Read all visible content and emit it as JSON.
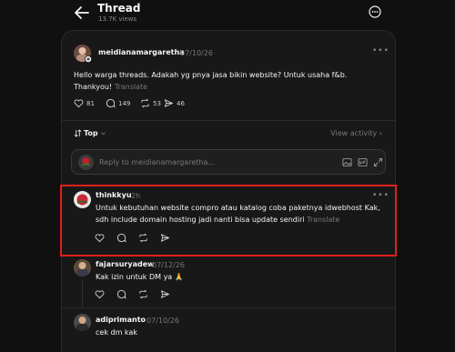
{
  "header": {
    "title": "Thread",
    "views": "13.7K views"
  },
  "main_post": {
    "username": "meidianamargaretha",
    "date": "07/10/26",
    "text_line1": "Hello warga threads. Adakah yg pnya jasa bikin website? Untuk usaha f&b.",
    "text_line2": "Thankyou!",
    "translate": "Translate",
    "likes": "81",
    "comments": "149",
    "reposts": "53",
    "shares": "46"
  },
  "sort": {
    "label": "Top",
    "view_activity": "View activity"
  },
  "reply": {
    "placeholder": "Reply to meidianamargaretha..."
  },
  "replies": [
    {
      "username": "thinkkyu",
      "time": "2h",
      "text_line1": "Untuk kebutuhan website compro atau katalog coba paketnya idwebhost Kak,",
      "text_line2": "sdh include domain hosting jadi nanti bisa update sendiri",
      "translate": "Translate"
    },
    {
      "username": "fajarsuryadew",
      "time": "07/12/26",
      "text_line1": "Kak izin untuk DM ya 🙏"
    },
    {
      "username": "adiprimanto",
      "time": "07/10/26",
      "text_line1": "cek dm kak"
    }
  ],
  "colors": {
    "background": "#101010",
    "card": "#181818",
    "highlight": "#e0201a",
    "muted": "#777777"
  }
}
